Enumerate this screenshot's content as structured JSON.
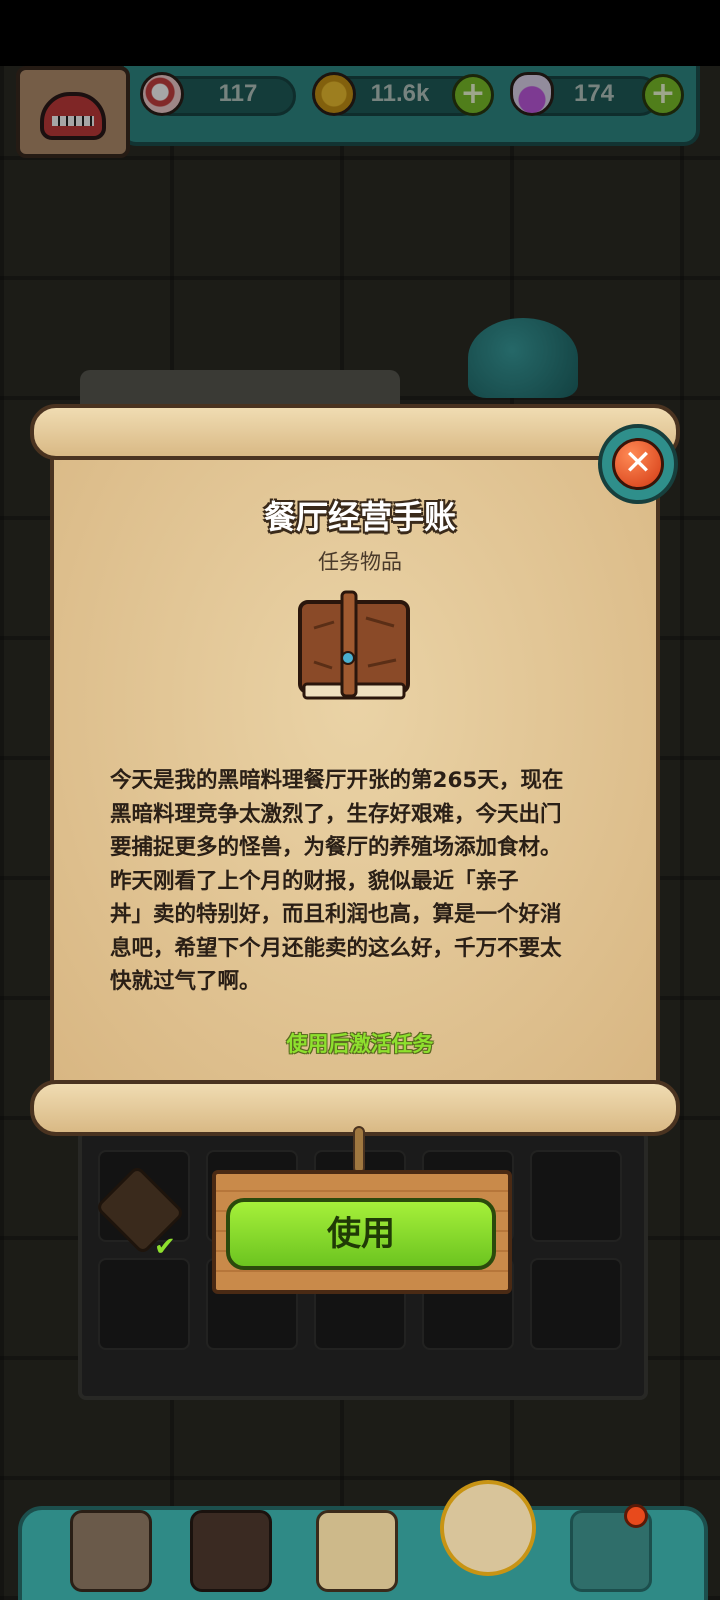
{
  "hud": {
    "eyes": {
      "icon": "eyeball-icon",
      "value": "117"
    },
    "coins": {
      "icon": "coin-icon",
      "value": "11.6k"
    },
    "potions": {
      "icon": "potion-icon",
      "value": "174"
    },
    "plus_label": "+"
  },
  "item_dialog": {
    "title": "餐厅经营手账",
    "subtitle": "任务物品",
    "icon": "ledger-book-icon",
    "description": [
      "今天是我的黑暗料理餐厅开张的第265天，现在",
      "黑暗料理竞争太激烈了，生存好艰难，今天出门",
      "要捕捉更多的怪兽，为餐厅的养殖场添加食材。",
      "昨天刚看了上个月的财报，貌似最近「亲子",
      "丼」卖的特别好，而且利润也高，算是一个好消",
      "息吧，希望下个月还能卖的这么好，千万不要太",
      "快就过气了啊。"
    ],
    "activate_note": "使用后激活任务",
    "close_label": "✕",
    "use_label": "使用"
  },
  "bottom_nav": {
    "items": [
      "restaurant-icon",
      "monster-cage-icon",
      "recipe-book-icon",
      "coin-bag-icon",
      "grid-menu-icon"
    ]
  },
  "colors": {
    "hud_teal": "#2f8a86",
    "use_button_green": "#8ee02e",
    "close_red": "#d33a14",
    "parchment": "#e2c792"
  }
}
